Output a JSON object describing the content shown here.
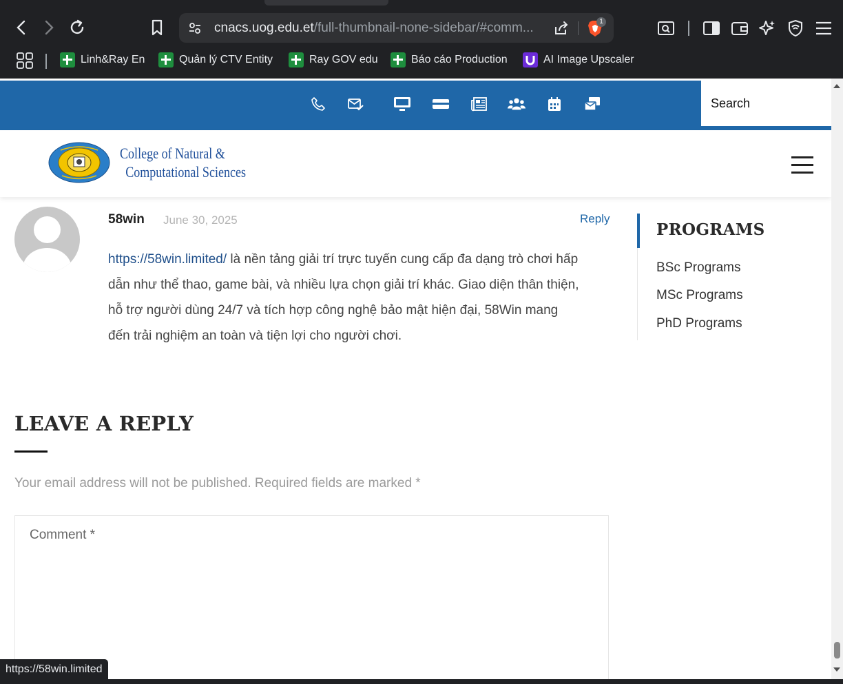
{
  "browser": {
    "url_host": "cnacs.uog.edu.et",
    "url_path": "/full-thumbnail-none-sidebar/#comm...",
    "brave_badge_count": "1",
    "status_link": "https://58win.limited"
  },
  "bookmarks": [
    {
      "label": "Linh&Ray En",
      "icon": "sheets-icon"
    },
    {
      "label": "Quản lý CTV Entity",
      "icon": "sheets-icon"
    },
    {
      "label": "Ray GOV edu",
      "icon": "sheets-icon"
    },
    {
      "label": "Báo cáo Production",
      "icon": "sheets-icon"
    },
    {
      "label": "AI Image Upscaler",
      "icon": "upscaler-icon"
    }
  ],
  "site": {
    "search_placeholder": "Search",
    "logo_line1": "College of Natural &",
    "logo_line2": "Computational Sciences",
    "brand_color": "#1f67a8"
  },
  "comment": {
    "author": "58win",
    "date": "June 30, 2025",
    "reply_label": "Reply",
    "link_text": "https://58win.limited/",
    "body": " là nền tảng giải trí trực tuyến cung cấp đa dạng trò chơi hấp dẫn như thể thao, game bài, và nhiều lựa chọn giải trí khác. Giao diện thân thiện, hỗ trợ người dùng 24/7 và tích hợp công nghệ bảo mật hiện đại, 58Win mang đến trải nghiệm an toàn và tiện lợi cho người chơi."
  },
  "sidebar": {
    "title": "PROGRAMS",
    "items": [
      "BSc Programs",
      "MSc Programs",
      "PhD Programs"
    ]
  },
  "reply_form": {
    "title": "LEAVE A REPLY",
    "note": "Your email address will not be published. Required fields are marked *",
    "comment_placeholder": "Comment *"
  }
}
